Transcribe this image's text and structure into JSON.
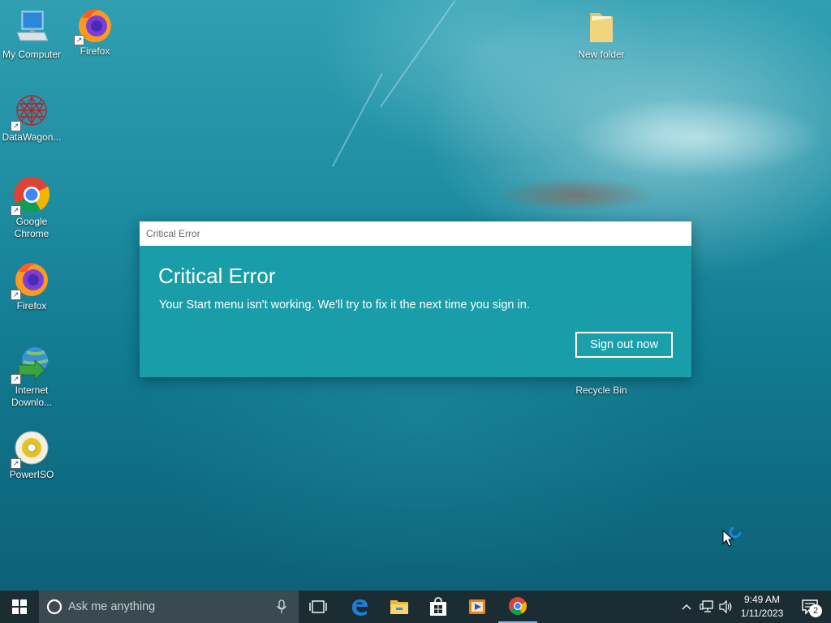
{
  "desktop": {
    "icons": [
      {
        "label": "My Computer"
      },
      {
        "label": "Firefox"
      },
      {
        "label": "DataWagon..."
      },
      {
        "label": "Google Chrome"
      },
      {
        "label": "Firefox"
      },
      {
        "label": "Internet Downlo..."
      },
      {
        "label": "PowerISO"
      },
      {
        "label": "New folder"
      },
      {
        "label": "Recycle Bin"
      }
    ]
  },
  "dialog": {
    "window_title": "Critical Error",
    "heading": "Critical Error",
    "message": "Your Start menu isn't working. We'll try to fix it the next time you sign in.",
    "button_label": "Sign out now",
    "background_color": "#199ea9"
  },
  "taskbar": {
    "search_placeholder": "Ask me anything",
    "clock": {
      "time": "9:49 AM",
      "date": "1/11/2023"
    },
    "notification_count": "2",
    "pinned_apps": [
      "task-view",
      "edge",
      "file-explorer",
      "store",
      "media-player",
      "chrome"
    ]
  }
}
